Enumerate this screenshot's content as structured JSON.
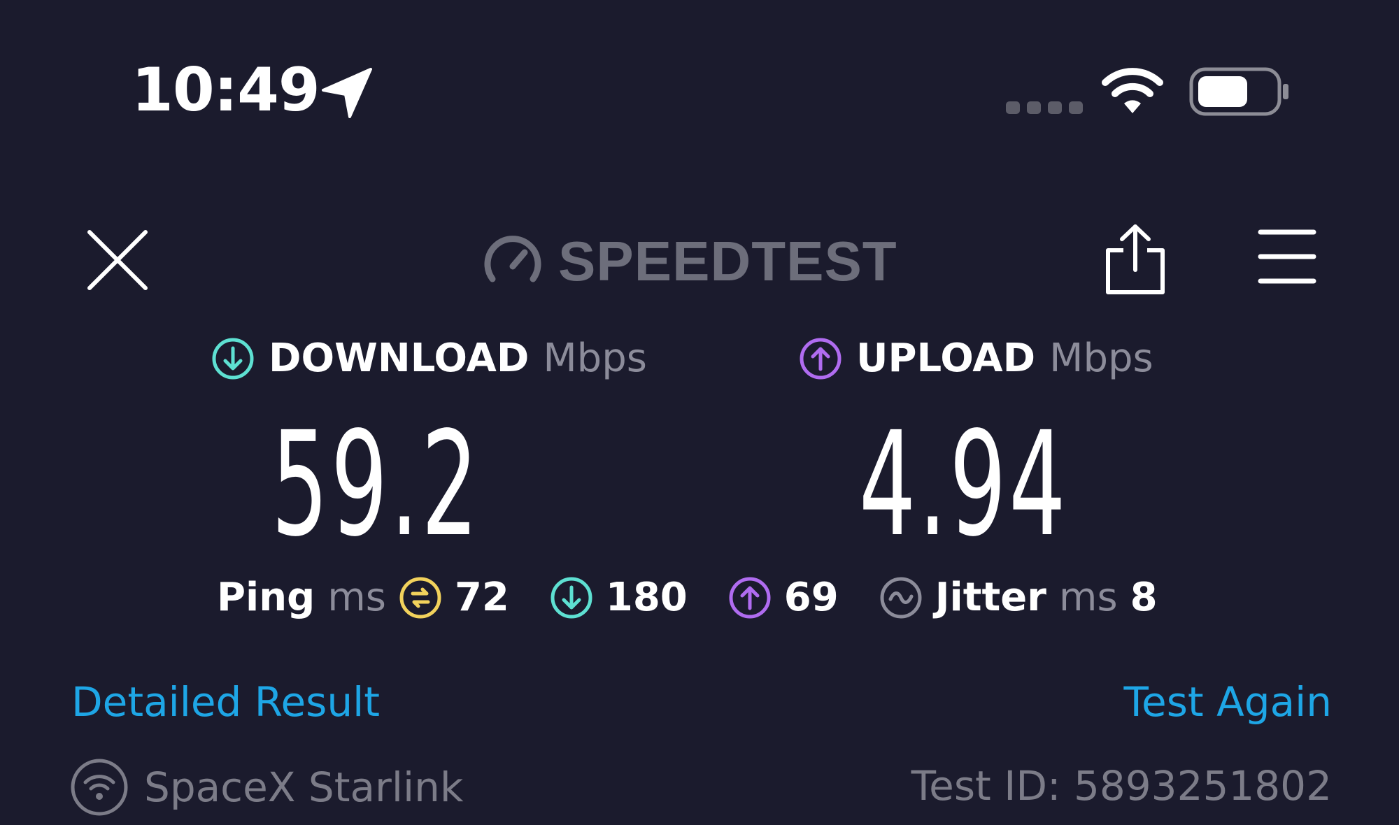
{
  "status_bar": {
    "time": "10:49",
    "location_icon": "location-arrow-icon",
    "signal_icon": "cellular-signal-icon",
    "wifi_icon": "wifi-icon",
    "battery_icon": "battery-icon"
  },
  "header": {
    "close_icon": "close-icon",
    "logo_text": "SPEEDTEST",
    "logo_icon": "speedometer-icon",
    "share_icon": "share-icon",
    "menu_icon": "hamburger-menu-icon"
  },
  "download": {
    "label": "DOWNLOAD",
    "unit": "Mbps",
    "value": "59.2",
    "icon": "download-arrow-icon",
    "color": "#5ee0d2"
  },
  "upload": {
    "label": "UPLOAD",
    "unit": "Mbps",
    "value": "4.94",
    "icon": "upload-arrow-icon",
    "color": "#b06cf0"
  },
  "ping": {
    "label": "Ping",
    "unit": "ms",
    "idle_value": "72",
    "idle_color": "#f2d25c",
    "download_value": "180",
    "upload_value": "69"
  },
  "jitter": {
    "label": "Jitter",
    "unit": "ms",
    "value": "8",
    "icon": "jitter-wave-icon"
  },
  "actions": {
    "detailed_result": "Detailed Result",
    "test_again": "Test Again",
    "link_color": "#1ea6e6"
  },
  "footer": {
    "provider": "SpaceX Starlink",
    "provider_icon": "wifi-circle-icon",
    "test_id": "Test ID: 5893251802"
  }
}
